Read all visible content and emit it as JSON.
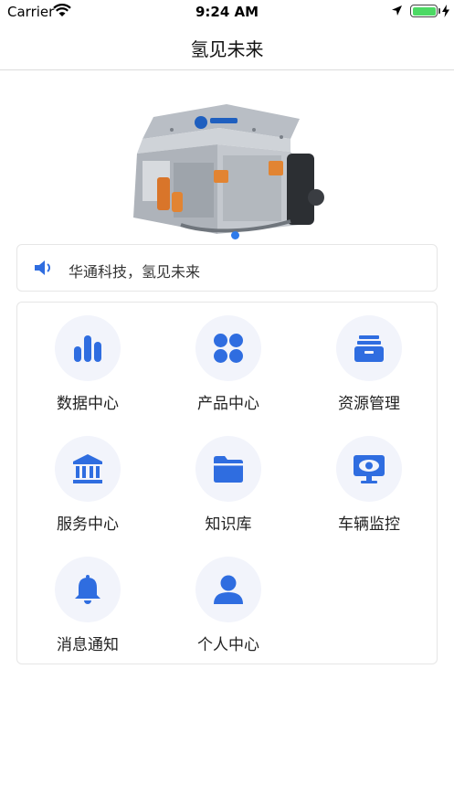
{
  "status_bar": {
    "carrier": "Carrier",
    "time": "9:24 AM",
    "icons": [
      "wifi-icon",
      "location-arrow-icon",
      "battery-icon",
      "charging-bolt-icon"
    ]
  },
  "nav": {
    "title": "氢见未来"
  },
  "banner": {
    "image": "fuel-cell-engine-image",
    "page_indicator": {
      "count": 1,
      "active_index": 0
    }
  },
  "notice": {
    "icon": "speaker-icon",
    "text": "华通科技，氢见未来"
  },
  "menu": {
    "items": [
      {
        "label": "数据中心",
        "icon": "bar-chart-icon"
      },
      {
        "label": "产品中心",
        "icon": "four-petal-icon"
      },
      {
        "label": "资源管理",
        "icon": "drawer-archive-icon"
      },
      {
        "label": "服务中心",
        "icon": "building-icon"
      },
      {
        "label": "知识库",
        "icon": "folder-icon"
      },
      {
        "label": "车辆监控",
        "icon": "monitor-eye-icon"
      },
      {
        "label": "消息通知",
        "icon": "bell-icon"
      },
      {
        "label": "个人中心",
        "icon": "person-icon"
      }
    ]
  },
  "colors": {
    "accent": "#2f6de0",
    "icon_bg": "#f2f4fb",
    "battery": "#4cd964"
  }
}
